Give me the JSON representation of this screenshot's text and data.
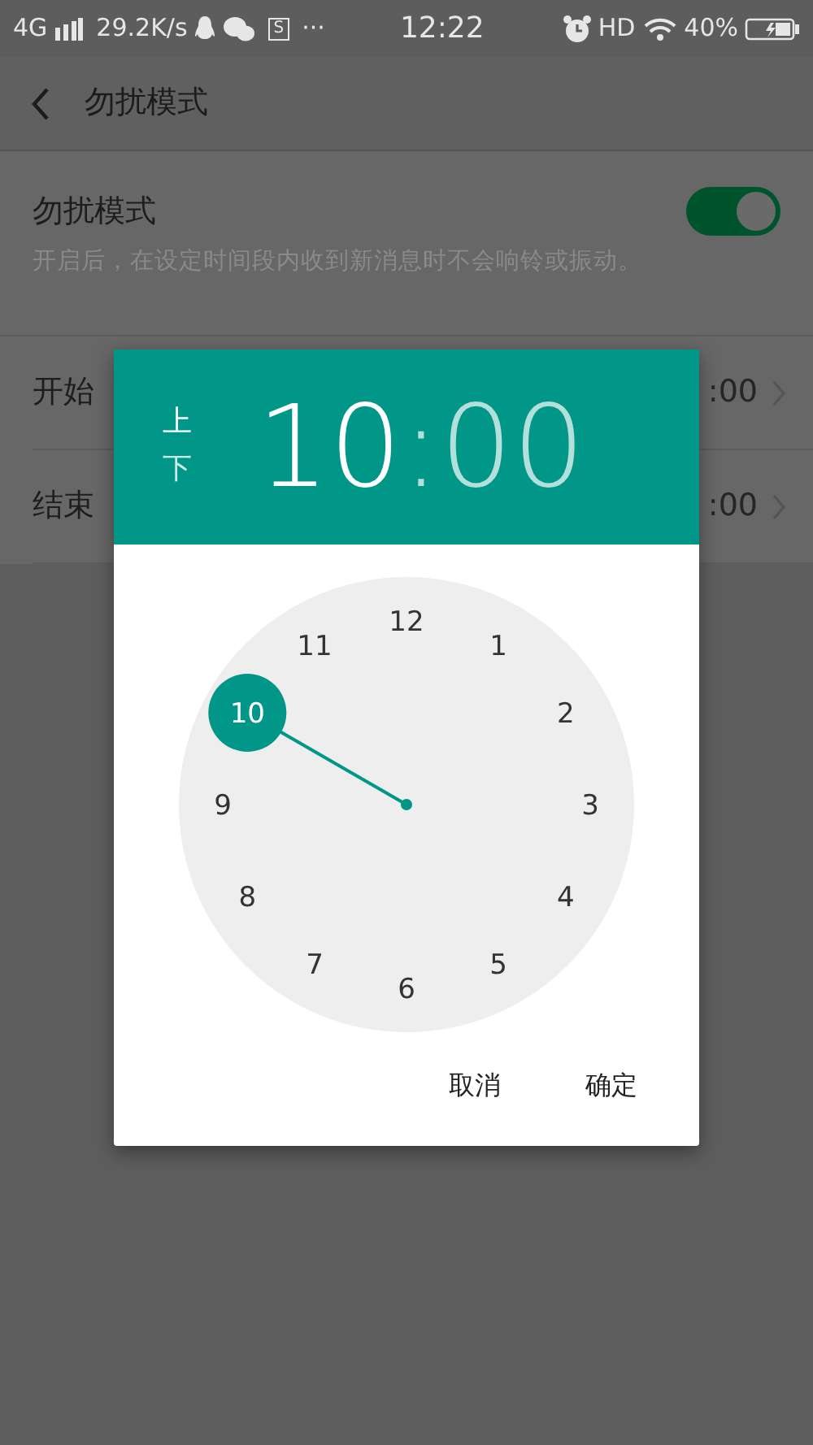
{
  "status_bar": {
    "network": "4G",
    "speed": "29.2K/s",
    "s_badge": "S",
    "more": "···",
    "time": "12:22",
    "hd": "HD",
    "battery": "40%"
  },
  "header": {
    "title": "勿扰模式"
  },
  "dnd": {
    "title": "勿扰模式",
    "description": "开启后，在设定时间段内收到新消息时不会响铃或振动。",
    "on": true
  },
  "rows": [
    {
      "label": "开始",
      "value": ":00"
    },
    {
      "label": "结束",
      "value": ":00"
    }
  ],
  "time_picker": {
    "periods": [
      {
        "label": "上",
        "selected": true
      },
      {
        "label": "下",
        "selected": false
      }
    ],
    "hour": {
      "text": "10",
      "selected": true
    },
    "separator": ":",
    "minute": {
      "text": "00",
      "selected": false
    },
    "dial": [
      {
        "label": "12",
        "selected": false
      },
      {
        "label": "1",
        "selected": false
      },
      {
        "label": "2",
        "selected": false
      },
      {
        "label": "3",
        "selected": false
      },
      {
        "label": "4",
        "selected": false
      },
      {
        "label": "5",
        "selected": false
      },
      {
        "label": "6",
        "selected": false
      },
      {
        "label": "7",
        "selected": false
      },
      {
        "label": "8",
        "selected": false
      },
      {
        "label": "9",
        "selected": false
      },
      {
        "label": "10",
        "selected": true
      },
      {
        "label": "11",
        "selected": false
      }
    ],
    "buttons": [
      "取消",
      "确定"
    ]
  }
}
